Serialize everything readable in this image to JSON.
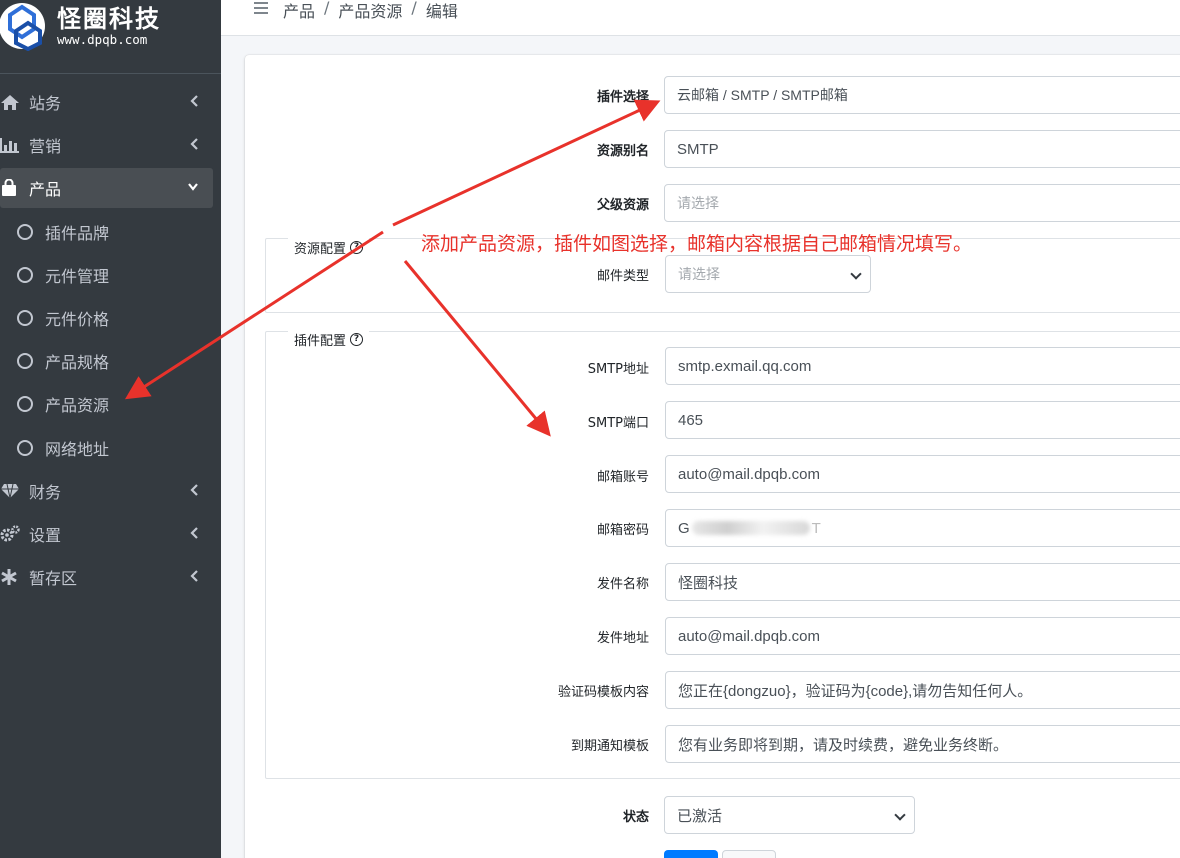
{
  "brand": {
    "name": "怪圈科技",
    "url": "www.dpqb.com"
  },
  "sidebar": {
    "items": [
      {
        "label": "站务",
        "icon": "home-icon"
      },
      {
        "label": "营销",
        "icon": "bar-chart-icon"
      },
      {
        "label": "产品",
        "icon": "shopping-bag-icon"
      },
      {
        "label": "财务",
        "icon": "diamond-icon"
      },
      {
        "label": "设置",
        "icon": "gears-icon"
      },
      {
        "label": "暂存区",
        "icon": "asterisk-icon"
      }
    ],
    "sub_items": [
      {
        "label": "插件品牌"
      },
      {
        "label": "元件管理"
      },
      {
        "label": "元件价格"
      },
      {
        "label": "产品规格"
      },
      {
        "label": "产品资源"
      },
      {
        "label": "网络地址"
      }
    ]
  },
  "breadcrumb": {
    "level1": "产品",
    "level2": "产品资源",
    "level3": "编辑",
    "separator": "/"
  },
  "form": {
    "plugin": {
      "label": "插件选择",
      "value": "云邮箱 / SMTP / SMTP邮箱"
    },
    "alias": {
      "label": "资源别名",
      "value": "SMTP"
    },
    "parent": {
      "label": "父级资源",
      "placeholder": "请选择"
    },
    "resource_config": {
      "legend": "资源配置",
      "mail_type": {
        "label": "邮件类型",
        "placeholder": "请选择"
      }
    },
    "plugin_config": {
      "legend": "插件配置",
      "smtp_host": {
        "label": "SMTP地址",
        "value": "smtp.exmail.qq.com"
      },
      "smtp_port": {
        "label": "SMTP端口",
        "value": "465"
      },
      "account": {
        "label": "邮箱账号",
        "value": "auto@mail.dpqb.com"
      },
      "password": {
        "label": "邮箱密码",
        "prefix": "G",
        "suffix": "T"
      },
      "sender_name": {
        "label": "发件名称",
        "value": "怪圈科技"
      },
      "sender_address": {
        "label": "发件地址",
        "value": "auto@mail.dpqb.com"
      },
      "code_template": {
        "label": "验证码模板内容",
        "value": "您正在{dongzuo}，验证码为{code},请勿告知任何人。"
      },
      "expire_template": {
        "label": "到期通知模板",
        "value": "您有业务即将到期，请及时续费，避免业务终断。"
      }
    },
    "status": {
      "label": "状态",
      "value": "已激活"
    }
  },
  "annotation": {
    "text": "添加产品资源，插件如图选择，邮箱内容根据自己邮箱情况填写。",
    "color": "#e8322b"
  },
  "colors": {
    "sidebar_bg": "#343a40",
    "primary": "#007bff",
    "annotation": "#e8322b"
  }
}
